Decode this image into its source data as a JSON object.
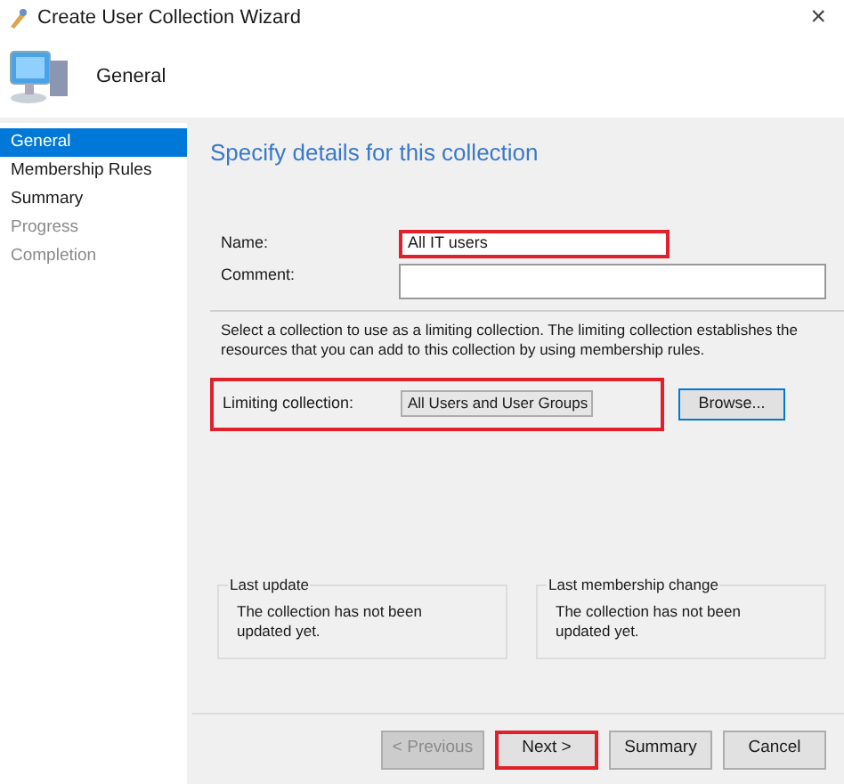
{
  "window": {
    "title": "Create User Collection Wizard",
    "close": "×"
  },
  "header": {
    "title": "General"
  },
  "sidebar": {
    "items": [
      {
        "label": "General",
        "selected": true,
        "disabled": false
      },
      {
        "label": "Membership Rules",
        "selected": false,
        "disabled": false
      },
      {
        "label": "Summary",
        "selected": false,
        "disabled": false
      },
      {
        "label": "Progress",
        "selected": false,
        "disabled": true
      },
      {
        "label": "Completion",
        "selected": false,
        "disabled": true
      }
    ]
  },
  "page": {
    "heading": "Specify details for this collection",
    "name": {
      "label": "Name:",
      "value": "All IT users",
      "highlighted": true
    },
    "comment": {
      "label": "Comment:"
    },
    "description": "Select a collection to use as a limiting collection. The limiting collection establishes the resources that you can add to this collection by using membership rules.",
    "limiting": {
      "label": "Limiting collection:",
      "value": "All Users and User Groups",
      "highlighted": true
    },
    "browse": "Browse...",
    "groups": [
      {
        "title": "Last update",
        "text": "The collection has not been updated yet."
      },
      {
        "title": "Last membership change",
        "text": "The collection has not been updated yet."
      }
    ]
  },
  "buttons": [
    {
      "label": "< Previous",
      "disabled": true,
      "highlighted": false
    },
    {
      "label": "Next >",
      "disabled": false,
      "highlighted": true
    },
    {
      "label": "Summary",
      "disabled": false,
      "highlighted": false
    },
    {
      "label": "Cancel",
      "disabled": false,
      "highlighted": false
    }
  ]
}
